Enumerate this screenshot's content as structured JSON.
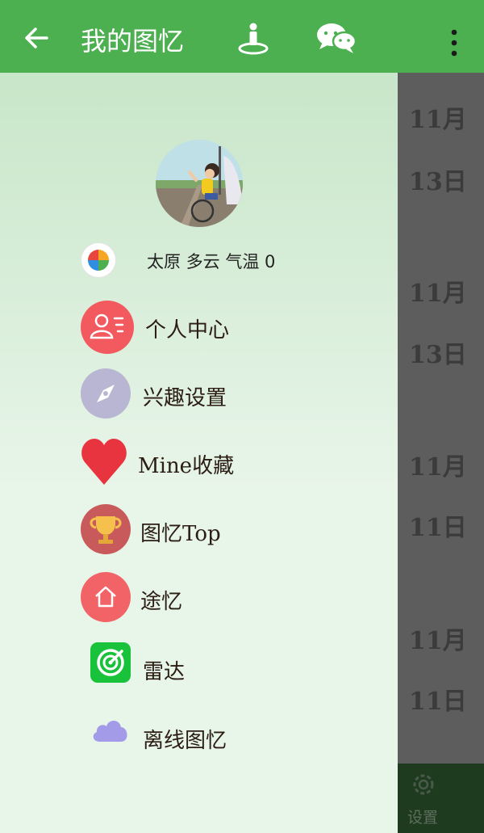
{
  "appbar": {
    "title": "我的图忆",
    "icons": [
      "back-arrow-icon",
      "person-info-icon",
      "wechat-icon",
      "more-vert-icon"
    ]
  },
  "drawer": {
    "weather": {
      "text": "太原  多云 气温 0"
    },
    "menu": [
      {
        "label": "个人中心",
        "icon": "profile-icon",
        "color": "#f25a5f"
      },
      {
        "label": "兴趣设置",
        "icon": "compass-icon",
        "color": "#b8b6d2"
      },
      {
        "label": "Mine收藏",
        "icon": "heart-icon",
        "color": "#e8343e"
      },
      {
        "label": "图忆Top",
        "icon": "trophy-icon",
        "color": "#c95a5c"
      },
      {
        "label": "途忆",
        "icon": "home-icon",
        "color": "#f26368"
      },
      {
        "label": "雷达",
        "icon": "radar-icon",
        "color": "#19c23b"
      },
      {
        "label": "离线图忆",
        "icon": "cloud-icon",
        "color": "#a49be8"
      }
    ]
  },
  "background_list": {
    "dates": [
      "11月",
      "13日",
      "11月",
      "13日",
      "11月",
      "11日",
      "11月",
      "11日"
    ]
  },
  "bottom": {
    "settings_label": "设置"
  },
  "colors": {
    "primary": "#4caf50",
    "dark_green": "#1e3a1f"
  }
}
